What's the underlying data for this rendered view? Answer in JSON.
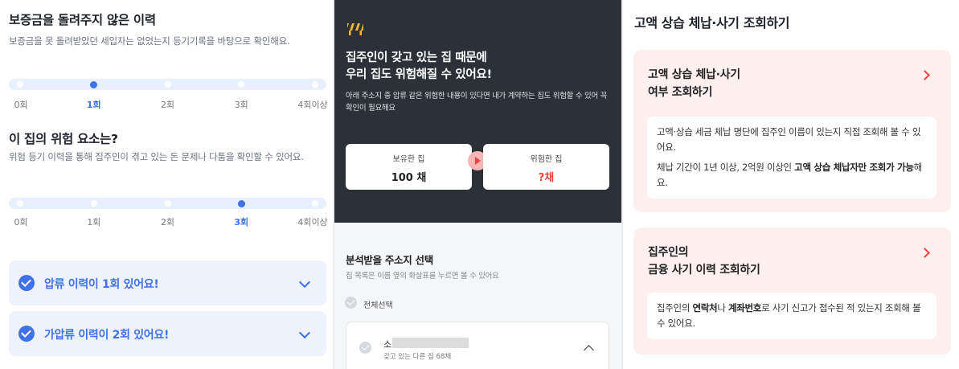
{
  "panel1": {
    "history_title": "보증금을 돌려주지 않은 이력",
    "history_desc": "보증금을 못 돌려받았던 세입자는 없었는지 등기기록을 바탕으로 확인해요.",
    "history_ticks": [
      "0회",
      "1회",
      "2회",
      "3회",
      "4회이상"
    ],
    "history_selected_index": 1,
    "risk_title": "이 집의 위험 요소는?",
    "risk_desc": "위험 등기 이력을 통해 집주인이 겪고 있는 돈 문제나 다툼을 확인할 수 있어요.",
    "risk_ticks": [
      "0회",
      "1회",
      "2회",
      "3회",
      "4회이상"
    ],
    "risk_selected_index": 3,
    "accordions": [
      {
        "label": "압류 이력이 1회 있어요!"
      },
      {
        "label": "가압류 이력이 2회 있어요!"
      }
    ],
    "accent_color": "#3f71e8"
  },
  "panel2": {
    "headline": "집주인이 갖고 있는 집 때문에\n우리 집도 위험해질 수 있어요!",
    "subtext": "아래 주소지 중 압류 같은 위험한 내용이 있다면 내가 계약하는 집도 위험할 수 있어 꼭 확인이 필요해요",
    "owned_label": "보유한 집",
    "owned_value": "100 채",
    "risky_label": "위험한 집",
    "risky_value": "?채",
    "section_title": "분석받을 주소지 선택",
    "section_sub": "집 목록은 이름 옆의 화살표를 누르면 볼 수 있어요",
    "select_all": "전체선택",
    "address_name": "소",
    "address_sub": "갖고 있는 다른 집 68채",
    "danger_color": "#e9433c"
  },
  "panel3": {
    "title": "고액 상습 체납·사기 조회하기",
    "card1_title": "고액 상습 체납·사기\n여부 조회하기",
    "card1_p1": "고액·상습 세금 체납 명단에 집주인 이름이 있는지 직접 조회해 볼 수 있어요.",
    "card1_p2_prefix": "체납 기간이 1년 이상, 2억원 이상인 ",
    "card1_p2_bold": "고액 상습 체납자만 조회가 가능",
    "card1_p2_suffix": "해요.",
    "card2_title": "집주인의\n금융 사기 이력 조회하기",
    "card2_p_prefix": "집주인의 ",
    "card2_p_bold1": "연락처",
    "card2_p_mid": "나 ",
    "card2_p_bold2": "계좌번호",
    "card2_p_suffix": "로 사기 신고가 접수된 적 있는지 조회해 볼 수 있어요."
  }
}
